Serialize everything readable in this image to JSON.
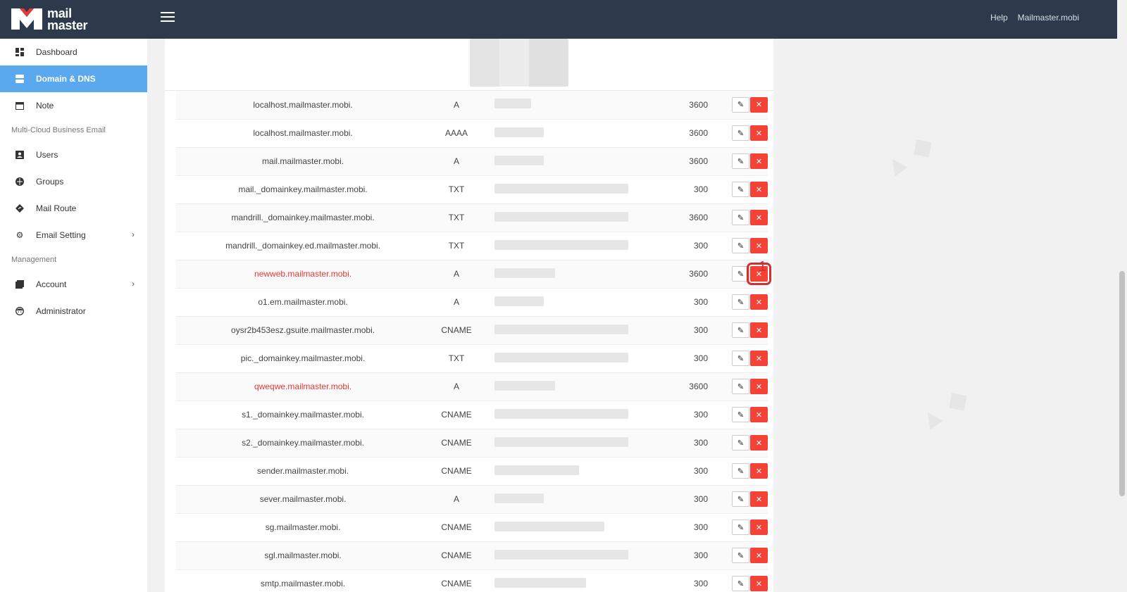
{
  "brand": {
    "line1": "mail",
    "line2": "master"
  },
  "topbar": {
    "help": "Help",
    "account": "Mailmaster.mobi"
  },
  "sidebar": {
    "items": [
      {
        "label": "Dashboard",
        "icon": "dashboard-icon"
      },
      {
        "label": "Domain & DNS",
        "icon": "server-icon",
        "active": true
      },
      {
        "label": "Note",
        "icon": "calendar-icon"
      }
    ],
    "section1": "Multi-Cloud Business Email",
    "items2": [
      {
        "label": "Users",
        "icon": "user-icon"
      },
      {
        "label": "Groups",
        "icon": "globe-icon"
      },
      {
        "label": "Mail Route",
        "icon": "route-icon"
      },
      {
        "label": "Email Setting",
        "icon": "gear-icon"
      }
    ],
    "section2": "Management",
    "items3": [
      {
        "label": "Account",
        "icon": "book-icon"
      },
      {
        "label": "Administrator",
        "icon": "face-icon"
      }
    ]
  },
  "records": [
    {
      "host": "localhost.mailmaster.mobi.",
      "type": "A",
      "ttl": "3600"
    },
    {
      "host": "localhost.mailmaster.mobi.",
      "type": "AAAA",
      "ttl": "3600"
    },
    {
      "host": "mail.mailmaster.mobi.",
      "type": "A",
      "ttl": "3600"
    },
    {
      "host": "mail._domainkey.mailmaster.mobi.",
      "type": "TXT",
      "ttl": "300"
    },
    {
      "host": "mandrill._domainkey.mailmaster.mobi.",
      "type": "TXT",
      "ttl": "3600"
    },
    {
      "host": "mandrill._domainkey.ed.mailmaster.mobi.",
      "type": "TXT",
      "ttl": "300"
    },
    {
      "host": "newweb.mailmaster.mobi.",
      "type": "A",
      "ttl": "3600",
      "highlighted": true
    },
    {
      "host": "o1.em.mailmaster.mobi.",
      "type": "A",
      "ttl": "300"
    },
    {
      "host": "oysr2b453esz.gsuite.mailmaster.mobi.",
      "type": "CNAME",
      "ttl": "300"
    },
    {
      "host": "pic._domainkey.mailmaster.mobi.",
      "type": "TXT",
      "ttl": "300"
    },
    {
      "host": "qweqwe.mailmaster.mobi.",
      "type": "A",
      "ttl": "3600",
      "highlighted": true
    },
    {
      "host": "s1._domainkey.mailmaster.mobi.",
      "type": "CNAME",
      "ttl": "300"
    },
    {
      "host": "s2._domainkey.mailmaster.mobi.",
      "type": "CNAME",
      "ttl": "300"
    },
    {
      "host": "sender.mailmaster.mobi.",
      "type": "CNAME",
      "ttl": "300"
    },
    {
      "host": "sever.mailmaster.mobi.",
      "type": "A",
      "ttl": "300"
    },
    {
      "host": "sg.mailmaster.mobi.",
      "type": "CNAME",
      "ttl": "300"
    },
    {
      "host": "sgl.mailmaster.mobi.",
      "type": "CNAME",
      "ttl": "300"
    },
    {
      "host": "smtp.mailmaster.mobi.",
      "type": "CNAME",
      "ttl": "300"
    }
  ],
  "annotation": "1",
  "colors": {
    "topbar": "#2c3a4b",
    "active": "#5aa9ee",
    "delete": "#f44336",
    "highlight_text": "#e53935"
  }
}
